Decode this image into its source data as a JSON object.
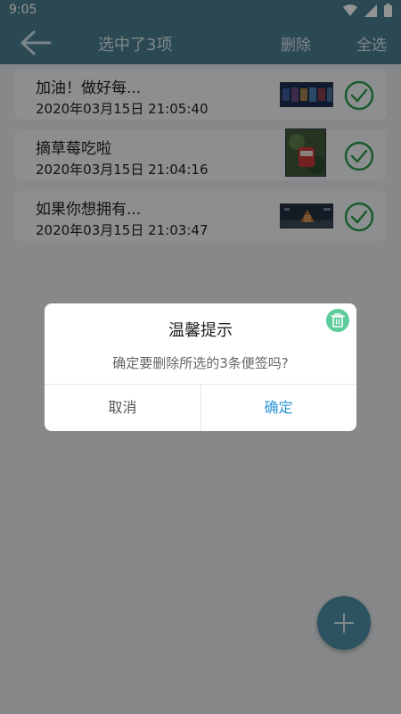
{
  "status_bar": {
    "time": "9:05"
  },
  "app_bar": {
    "title": "选中了3项",
    "delete_label": "删除",
    "select_all_label": "全选"
  },
  "notes": [
    {
      "title": "加油！做好每...",
      "date": "2020年03月15日 21:05:40",
      "checked": true
    },
    {
      "title": "摘草莓吃啦",
      "date": "2020年03月15日 21:04:16",
      "checked": true
    },
    {
      "title": "如果你想拥有...",
      "date": "2020年03月15日 21:03:47",
      "checked": true
    }
  ],
  "dialog": {
    "title": "温馨提示",
    "message": "确定要删除所选的3条便签吗?",
    "cancel_label": "取消",
    "ok_label": "确定"
  },
  "colors": {
    "primary": "#4a7f8f",
    "check_green": "#2e9e4f",
    "confirm_blue": "#2a93d5",
    "trash_green": "#5ccc9a"
  }
}
